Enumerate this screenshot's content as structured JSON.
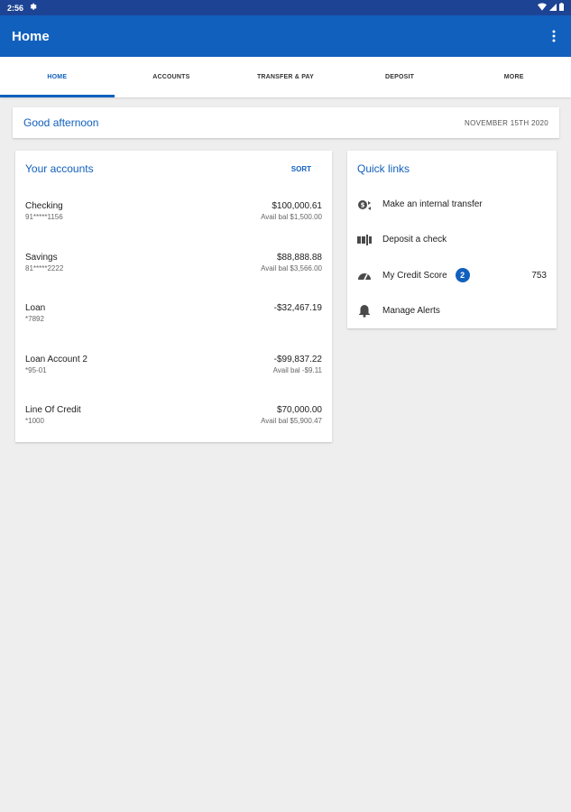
{
  "status_bar": {
    "time": "2:56"
  },
  "app_bar": {
    "title": "Home"
  },
  "tabs": [
    {
      "label": "HOME",
      "active": true
    },
    {
      "label": "ACCOUNTS",
      "active": false
    },
    {
      "label": "TRANSFER & PAY",
      "active": false
    },
    {
      "label": "DEPOSIT",
      "active": false
    },
    {
      "label": "MORE",
      "active": false
    }
  ],
  "greeting": {
    "text": "Good afternoon",
    "date": "NOVEMBER 15TH 2020"
  },
  "accounts": {
    "title": "Your accounts",
    "sort_label": "SORT",
    "items": [
      {
        "name": "Checking",
        "number": "91*****1156",
        "balance": "$100,000.61",
        "avail": "Avail bal $1,500.00"
      },
      {
        "name": "Savings",
        "number": "81*****2222",
        "balance": "$88,888.88",
        "avail": "Avail bal $3,566.00"
      },
      {
        "name": "Loan",
        "number": "*7892",
        "balance": "-$32,467.19",
        "avail": ""
      },
      {
        "name": "Loan Account 2",
        "number": "*95-01",
        "balance": "-$99,837.22",
        "avail": "Avail bal -$9.11"
      },
      {
        "name": "Line Of Credit",
        "number": "*1000",
        "balance": "$70,000.00",
        "avail": "Avail bal $5,900.47"
      }
    ]
  },
  "quick_links": {
    "title": "Quick links",
    "items": [
      {
        "label": "Make an internal transfer",
        "icon": "transfer-icon"
      },
      {
        "label": "Deposit a check",
        "icon": "check-deposit-icon"
      },
      {
        "label": "My Credit Score",
        "icon": "gauge-icon",
        "badge": "2",
        "value": "753"
      },
      {
        "label": "Manage Alerts",
        "icon": "bell-icon"
      }
    ]
  },
  "colors": {
    "primary": "#1160bd",
    "status_bar": "#1d4494",
    "background": "#eeeeee"
  }
}
